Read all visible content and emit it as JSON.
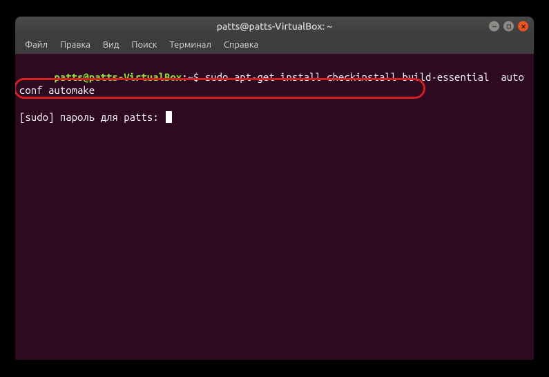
{
  "window": {
    "title": "patts@patts-VirtualBox: ~"
  },
  "menubar": {
    "items": [
      {
        "label": "Файл"
      },
      {
        "label": "Правка"
      },
      {
        "label": "Вид"
      },
      {
        "label": "Поиск"
      },
      {
        "label": "Терминал"
      },
      {
        "label": "Справка"
      }
    ]
  },
  "terminal": {
    "prompt_user": "patts@patts-VirtualBox",
    "prompt_sep": ":",
    "prompt_path": "~",
    "prompt_symbol": "$",
    "command": " sudo apt-get install checkinstall build-essential  autoconf automake",
    "sudo_line": "[sudo] пароль для patts: "
  }
}
